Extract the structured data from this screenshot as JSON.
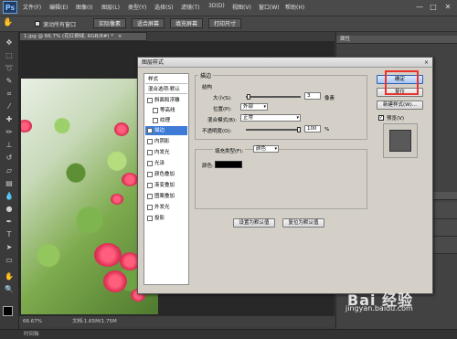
{
  "menubar": {
    "logo": "Ps",
    "items": [
      "文件(F)",
      "编辑(E)",
      "图像(I)",
      "图层(L)",
      "类型(Y)",
      "选择(S)",
      "滤镜(T)",
      "3D(D)",
      "视图(V)",
      "窗口(W)",
      "帮助(H)"
    ],
    "win_min": "—",
    "win_max": "□",
    "win_close": "✕"
  },
  "optbar": {
    "scroll_all_label": "滚动所有窗口",
    "btn_actual": "实际像素",
    "btn_fit": "适合屏幕",
    "btn_fill": "填充屏幕",
    "btn_print": "打印尺寸"
  },
  "doc": {
    "tab_title": "1.jpg @ 66.7% (花红柳绿, RGB/8#) *",
    "close": "×"
  },
  "status": {
    "zoom": "66.67%",
    "docinfo": "文档:1.65M/1.75M"
  },
  "bottom_tab": "时间轴",
  "right_panel": {
    "head1": "属性",
    "head2": "图层"
  },
  "dialog": {
    "title": "图层样式",
    "close": "×",
    "style_items": [
      {
        "label": "样式",
        "type": "head"
      },
      {
        "label": "混合选项:默认",
        "type": "head"
      },
      {
        "label": "斜面和浮雕",
        "checked": false
      },
      {
        "label": "等高线",
        "checked": false,
        "indent": true
      },
      {
        "label": "纹理",
        "checked": false,
        "indent": true
      },
      {
        "label": "描边",
        "checked": true,
        "selected": true
      },
      {
        "label": "内阴影",
        "checked": false
      },
      {
        "label": "内发光",
        "checked": false
      },
      {
        "label": "光泽",
        "checked": false
      },
      {
        "label": "颜色叠加",
        "checked": false
      },
      {
        "label": "渐变叠加",
        "checked": false
      },
      {
        "label": "图案叠加",
        "checked": false
      },
      {
        "label": "外发光",
        "checked": false
      },
      {
        "label": "投影",
        "checked": false
      }
    ],
    "stroke": {
      "group_title": "描边",
      "structure_title": "结构",
      "size_label": "大小(S):",
      "size_value": "3",
      "size_unit": "像素",
      "size_fraction": 0.02,
      "position_label": "位置(P):",
      "position_value": "外部",
      "blend_label": "混合模式(B):",
      "blend_value": "正常",
      "opacity_label": "不透明度(O):",
      "opacity_value": "100",
      "opacity_unit": "%",
      "opacity_fraction": 1.0,
      "fill_type_label": "填充类型(F):",
      "fill_type_value": "颜色",
      "color_label": "颜色:",
      "color_value": "#000000",
      "set_default": "设置为默认值",
      "reset_default": "复位为默认值"
    },
    "buttons": {
      "ok": "确定",
      "reset": "复位",
      "new_style": "新建样式(W)...",
      "preview": "预览(V)",
      "preview_checked": true
    },
    "highlight_color": "#e8322b"
  },
  "watermark": {
    "brand": "Bai 经验",
    "url": "jingyan.baidu.com"
  }
}
